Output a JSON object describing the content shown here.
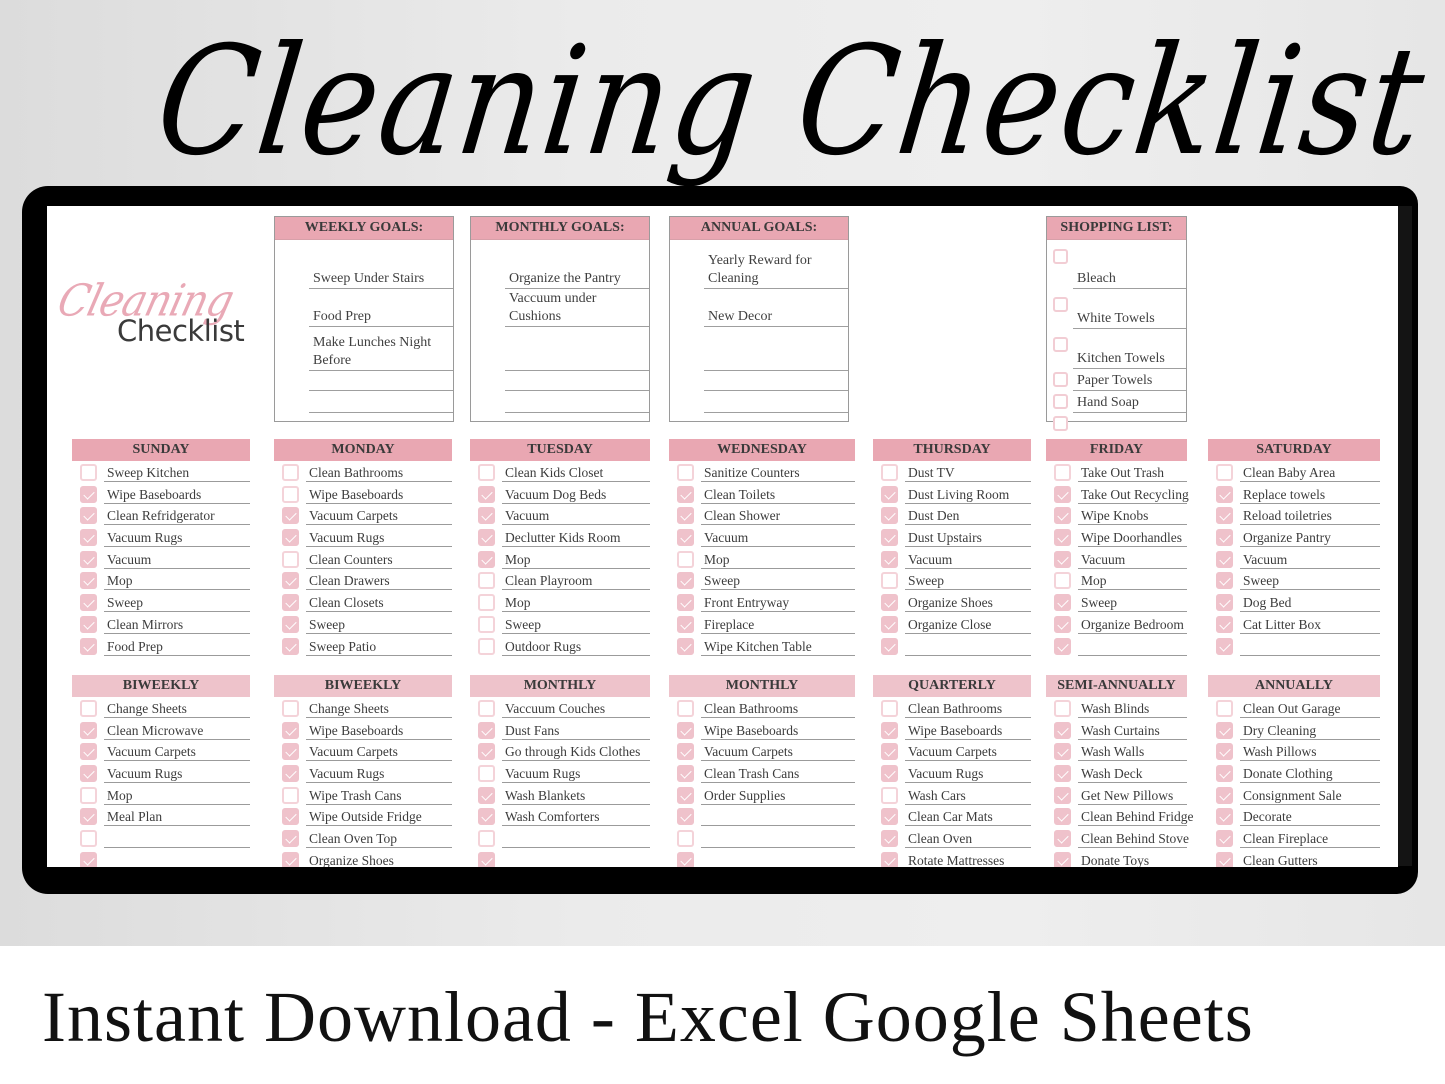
{
  "banner": {
    "title": "Cleaning Checklist",
    "footer": "Instant Download - Excel Google Sheets"
  },
  "sheet": {
    "logo": {
      "script": "Cleaning",
      "word": "Checklist"
    },
    "colors": {
      "header_pink": "#e9a7b2",
      "header_light_pink": "#eec3cb",
      "checkbox_checked": "#efc2cb",
      "checkbox_border": "#f4d3d9"
    },
    "goals": [
      {
        "title": "WEEKLY GOALS:",
        "items": [
          "Sweep Under Stairs",
          "Food Prep",
          "Make Lunches Night Before",
          "",
          "",
          ""
        ]
      },
      {
        "title": "MONTHLY GOALS:",
        "items": [
          "Organize the Pantry",
          "Vaccuum under Cushions",
          "",
          "",
          "",
          ""
        ]
      },
      {
        "title": "ANNUAL GOALS:",
        "items": [
          "Yearly Reward for Cleaning",
          "New Decor",
          "",
          "",
          "",
          ""
        ]
      }
    ],
    "shopping": {
      "title": "SHOPPING LIST:",
      "items": [
        {
          "label": "Bleach",
          "checked": false
        },
        {
          "label": "White Towels",
          "checked": false
        },
        {
          "label": "Kitchen Towels",
          "checked": false
        },
        {
          "label": "Paper Towels",
          "checked": false
        },
        {
          "label": "Hand Soap",
          "checked": false
        },
        {
          "label": "",
          "checked": false
        }
      ]
    },
    "daily": [
      {
        "title": "SUNDAY",
        "items": [
          {
            "label": "Sweep Kitchen",
            "checked": false
          },
          {
            "label": "Wipe Baseboards",
            "checked": true
          },
          {
            "label": "Clean Refridgerator",
            "checked": true
          },
          {
            "label": "Vacuum Rugs",
            "checked": true
          },
          {
            "label": "Vacuum",
            "checked": true
          },
          {
            "label": "Mop",
            "checked": true
          },
          {
            "label": "Sweep",
            "checked": true
          },
          {
            "label": "Clean Mirrors",
            "checked": true
          },
          {
            "label": "Food Prep",
            "checked": true
          }
        ]
      },
      {
        "title": "MONDAY",
        "items": [
          {
            "label": "Clean Bathrooms",
            "checked": false
          },
          {
            "label": "Wipe Baseboards",
            "checked": false
          },
          {
            "label": "Vacuum Carpets",
            "checked": true
          },
          {
            "label": "Vacuum Rugs",
            "checked": true
          },
          {
            "label": "Clean Counters",
            "checked": false
          },
          {
            "label": "Clean Drawers",
            "checked": true
          },
          {
            "label": "Clean Closets",
            "checked": true
          },
          {
            "label": "Sweep",
            "checked": true
          },
          {
            "label": "Sweep Patio",
            "checked": true
          }
        ]
      },
      {
        "title": "TUESDAY",
        "items": [
          {
            "label": "Clean Kids Closet",
            "checked": false
          },
          {
            "label": "Vacuum Dog Beds",
            "checked": true
          },
          {
            "label": "Vacuum",
            "checked": true
          },
          {
            "label": "Declutter Kids Room",
            "checked": true
          },
          {
            "label": "Mop",
            "checked": true
          },
          {
            "label": "Clean Playroom",
            "checked": false
          },
          {
            "label": "Mop",
            "checked": false
          },
          {
            "label": "Sweep",
            "checked": false
          },
          {
            "label": "Outdoor Rugs",
            "checked": false
          }
        ]
      },
      {
        "title": "WEDNESDAY",
        "items": [
          {
            "label": "Sanitize Counters",
            "checked": false
          },
          {
            "label": "Clean Toilets",
            "checked": true
          },
          {
            "label": "Clean Shower",
            "checked": true
          },
          {
            "label": "Vacuum",
            "checked": true
          },
          {
            "label": "Mop",
            "checked": false
          },
          {
            "label": "Sweep",
            "checked": true
          },
          {
            "label": "Front Entryway",
            "checked": true
          },
          {
            "label": "Fireplace",
            "checked": true
          },
          {
            "label": "Wipe Kitchen Table",
            "checked": true
          }
        ]
      },
      {
        "title": "THURSDAY",
        "items": [
          {
            "label": "Dust TV",
            "checked": false
          },
          {
            "label": "Dust Living Room",
            "checked": true
          },
          {
            "label": "Dust Den",
            "checked": true
          },
          {
            "label": "Dust Upstairs",
            "checked": true
          },
          {
            "label": "Vacuum",
            "checked": true
          },
          {
            "label": "Sweep",
            "checked": false
          },
          {
            "label": "Organize Shoes",
            "checked": true
          },
          {
            "label": "Organize Close",
            "checked": true
          },
          {
            "label": "",
            "checked": true
          }
        ]
      },
      {
        "title": "FRIDAY",
        "items": [
          {
            "label": "Take Out Trash",
            "checked": false
          },
          {
            "label": "Take Out Recycling",
            "checked": true
          },
          {
            "label": "Wipe Knobs",
            "checked": true
          },
          {
            "label": "Wipe Doorhandles",
            "checked": true
          },
          {
            "label": "Vacuum",
            "checked": true
          },
          {
            "label": "Mop",
            "checked": false
          },
          {
            "label": "Sweep",
            "checked": true
          },
          {
            "label": "Organize Bedroom",
            "checked": true
          },
          {
            "label": "",
            "checked": true
          }
        ]
      },
      {
        "title": "SATURDAY",
        "items": [
          {
            "label": "Clean Baby Area",
            "checked": false
          },
          {
            "label": "Replace towels",
            "checked": true
          },
          {
            "label": "Reload toiletries",
            "checked": true
          },
          {
            "label": "Organize Pantry",
            "checked": true
          },
          {
            "label": "Vacuum",
            "checked": true
          },
          {
            "label": "Sweep",
            "checked": true
          },
          {
            "label": "Dog Bed",
            "checked": true
          },
          {
            "label": "Cat Litter Box",
            "checked": true
          },
          {
            "label": "",
            "checked": true
          }
        ]
      }
    ],
    "periodic": [
      {
        "title": "BIWEEKLY",
        "items": [
          {
            "label": "Change Sheets",
            "checked": false
          },
          {
            "label": "Clean Microwave",
            "checked": true
          },
          {
            "label": "Vacuum Carpets",
            "checked": true
          },
          {
            "label": "Vacuum Rugs",
            "checked": true
          },
          {
            "label": "Mop",
            "checked": false
          },
          {
            "label": "Meal Plan",
            "checked": true
          },
          {
            "label": "",
            "checked": false
          },
          {
            "label": "",
            "checked": true
          }
        ]
      },
      {
        "title": "BIWEEKLY",
        "items": [
          {
            "label": "Change Sheets",
            "checked": false
          },
          {
            "label": "Wipe Baseboards",
            "checked": true
          },
          {
            "label": "Vacuum Carpets",
            "checked": true
          },
          {
            "label": "Vacuum Rugs",
            "checked": true
          },
          {
            "label": "Wipe Trash Cans",
            "checked": false
          },
          {
            "label": "Wipe Outside Fridge",
            "checked": true
          },
          {
            "label": "Clean Oven Top",
            "checked": true
          },
          {
            "label": "Organize Shoes",
            "checked": true
          }
        ]
      },
      {
        "title": "MONTHLY",
        "items": [
          {
            "label": "Vaccuum Couches",
            "checked": false
          },
          {
            "label": "Dust Fans",
            "checked": true
          },
          {
            "label": "Go through Kids Clothes",
            "checked": true
          },
          {
            "label": "Vacuum Rugs",
            "checked": false
          },
          {
            "label": "Wash Blankets",
            "checked": true
          },
          {
            "label": "Wash Comforters",
            "checked": true
          },
          {
            "label": "",
            "checked": false
          },
          {
            "label": "",
            "checked": true
          }
        ]
      },
      {
        "title": "MONTHLY",
        "items": [
          {
            "label": "Clean Bathrooms",
            "checked": false
          },
          {
            "label": "Wipe Baseboards",
            "checked": true
          },
          {
            "label": "Vacuum Carpets",
            "checked": true
          },
          {
            "label": "Clean Trash Cans",
            "checked": true
          },
          {
            "label": "Order Supplies",
            "checked": true
          },
          {
            "label": "",
            "checked": true
          },
          {
            "label": "",
            "checked": false
          },
          {
            "label": "",
            "checked": true
          }
        ]
      },
      {
        "title": "QUARTERLY",
        "items": [
          {
            "label": "Clean Bathrooms",
            "checked": false
          },
          {
            "label": "Wipe Baseboards",
            "checked": true
          },
          {
            "label": "Vacuum Carpets",
            "checked": true
          },
          {
            "label": "Vacuum Rugs",
            "checked": true
          },
          {
            "label": "Wash Cars",
            "checked": false
          },
          {
            "label": "Clean Car Mats",
            "checked": true
          },
          {
            "label": "Clean Oven",
            "checked": true
          },
          {
            "label": "Rotate Mattresses",
            "checked": true
          }
        ]
      },
      {
        "title": "SEMI-ANNUALLY",
        "items": [
          {
            "label": "Wash Blinds",
            "checked": false
          },
          {
            "label": "Wash Curtains",
            "checked": true
          },
          {
            "label": "Wash Walls",
            "checked": true
          },
          {
            "label": "Wash Deck",
            "checked": true
          },
          {
            "label": "Get New Pillows",
            "checked": true
          },
          {
            "label": "Clean Behind Fridge",
            "checked": true
          },
          {
            "label": "Clean Behind Stove",
            "checked": true
          },
          {
            "label": "Donate Toys",
            "checked": true
          }
        ]
      },
      {
        "title": "ANNUALLY",
        "items": [
          {
            "label": "Clean Out Garage",
            "checked": false
          },
          {
            "label": "Dry Cleaning",
            "checked": true
          },
          {
            "label": "Wash Pillows",
            "checked": true
          },
          {
            "label": "Donate Clothing",
            "checked": true
          },
          {
            "label": "Consignment Sale",
            "checked": true
          },
          {
            "label": "Decorate",
            "checked": true
          },
          {
            "label": "Clean Fireplace",
            "checked": true
          },
          {
            "label": "Clean Gutters",
            "checked": true
          }
        ]
      }
    ]
  }
}
